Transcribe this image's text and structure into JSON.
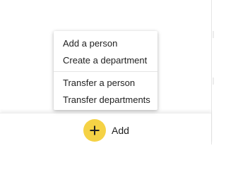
{
  "menu": {
    "items": [
      {
        "label": "Add a person"
      },
      {
        "label": "Create a department"
      },
      {
        "label": "Transfer a person"
      },
      {
        "label": "Transfer departments"
      }
    ]
  },
  "footer": {
    "add_label": "Add",
    "add_icon": "plus-icon",
    "accent_color": "#f5d245"
  }
}
